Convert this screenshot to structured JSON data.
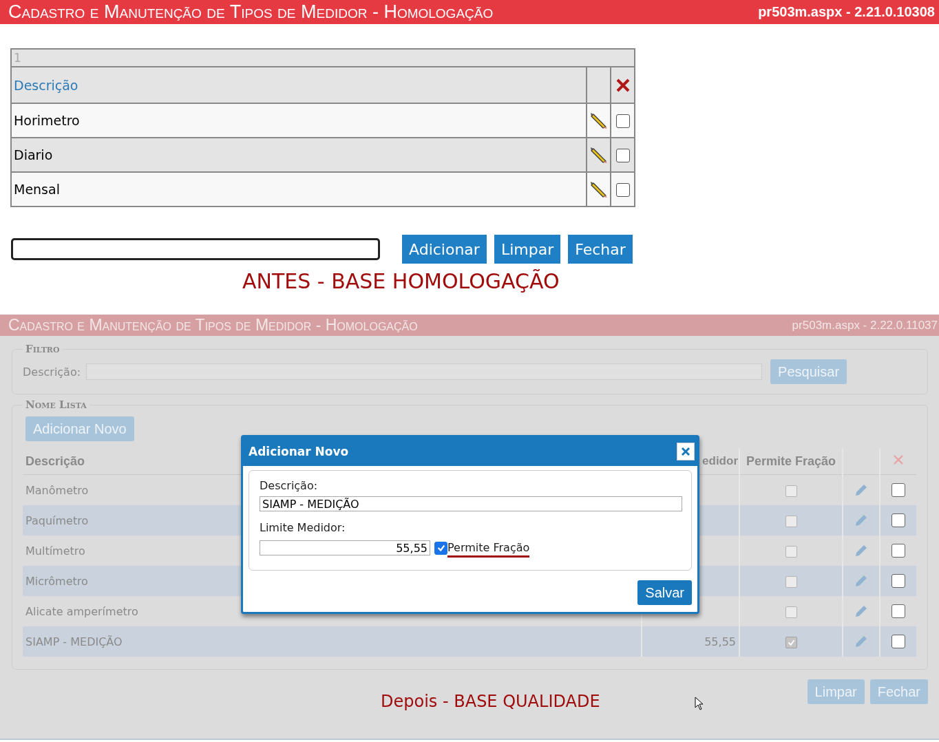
{
  "before": {
    "header": {
      "title": "Cadastro e Manutenção de Tipos de Medidor  - Homologação",
      "version": "pr503m.aspx - 2.21.0.10308"
    },
    "table": {
      "pager": "1",
      "columns": [
        "Descrição"
      ],
      "rows": [
        {
          "description": "Horimetro",
          "checked": false
        },
        {
          "description": "Diario",
          "checked": false
        },
        {
          "description": "Mensal",
          "checked": false
        }
      ]
    },
    "buttons": [
      "Adicionar",
      "Limpar",
      "Fechar"
    ],
    "caption": "ANTES - BASE HOMOLOGAÇÃO"
  },
  "after": {
    "header": {
      "title": "Cadastro e Manutenção de Tipos de Medidor  - Homologação",
      "version": "pr503m.aspx - 2.22.0.11037"
    },
    "filter": {
      "legend": "Filtro",
      "label": "Descrição:",
      "button": "Pesquisar"
    },
    "list": {
      "legend": "Nome Lista",
      "add_button": "Adicionar Novo",
      "columns": [
        "Descrição",
        "edidor",
        "Permite Fração"
      ],
      "rows": [
        {
          "description": "Manômetro",
          "limit": "",
          "fraction": false,
          "checked": false
        },
        {
          "description": "Paquímetro",
          "limit": "",
          "fraction": false,
          "checked": false
        },
        {
          "description": "Multímetro",
          "limit": "",
          "fraction": false,
          "checked": false
        },
        {
          "description": "Micrômetro",
          "limit": "",
          "fraction": false,
          "checked": false
        },
        {
          "description": "Alicate amperímetro",
          "limit": "",
          "fraction": false,
          "checked": false
        },
        {
          "description": "SIAMP - MEDIÇÃO",
          "limit": "55,55",
          "fraction": true,
          "checked": false
        }
      ]
    },
    "buttons": [
      "Limpar",
      "Fechar"
    ],
    "caption": "Depois - BASE QUALIDADE"
  },
  "modal": {
    "title": "Adicionar Novo",
    "description_label": "Descrição:",
    "description_value": "SIAMP - MEDIÇÃO",
    "limit_label": "Limite Medidor:",
    "limit_value": "55,55",
    "fraction_label": "Permite Fração",
    "fraction_checked": true,
    "save_button": "Salvar"
  }
}
